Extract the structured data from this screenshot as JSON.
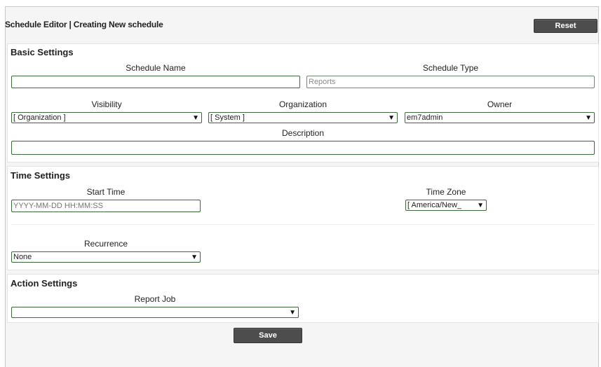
{
  "header": {
    "title": "Schedule Editor | Creating New schedule",
    "reset_label": "Reset"
  },
  "basic": {
    "title": "Basic Settings",
    "schedule_name_label": "Schedule Name",
    "schedule_name_value": "",
    "schedule_type_label": "Schedule Type",
    "schedule_type_value": "Reports",
    "visibility_label": "Visibility",
    "visibility_value": "[ Organization ]",
    "organization_label": "Organization",
    "organization_value": "[ System ]",
    "owner_label": "Owner",
    "owner_value": "em7admin",
    "description_label": "Description",
    "description_value": ""
  },
  "time": {
    "title": "Time Settings",
    "start_time_label": "Start Time",
    "start_time_placeholder": "YYYY-MM-DD HH:MM:SS",
    "time_zone_label": "Time Zone",
    "time_zone_value": "[ America/New_",
    "recurrence_label": "Recurrence",
    "recurrence_value": "None"
  },
  "action": {
    "title": "Action Settings",
    "report_job_label": "Report Job",
    "report_job_value": ""
  },
  "footer": {
    "save_label": "Save"
  },
  "icons": {
    "dropdown_arrow": "▼"
  }
}
